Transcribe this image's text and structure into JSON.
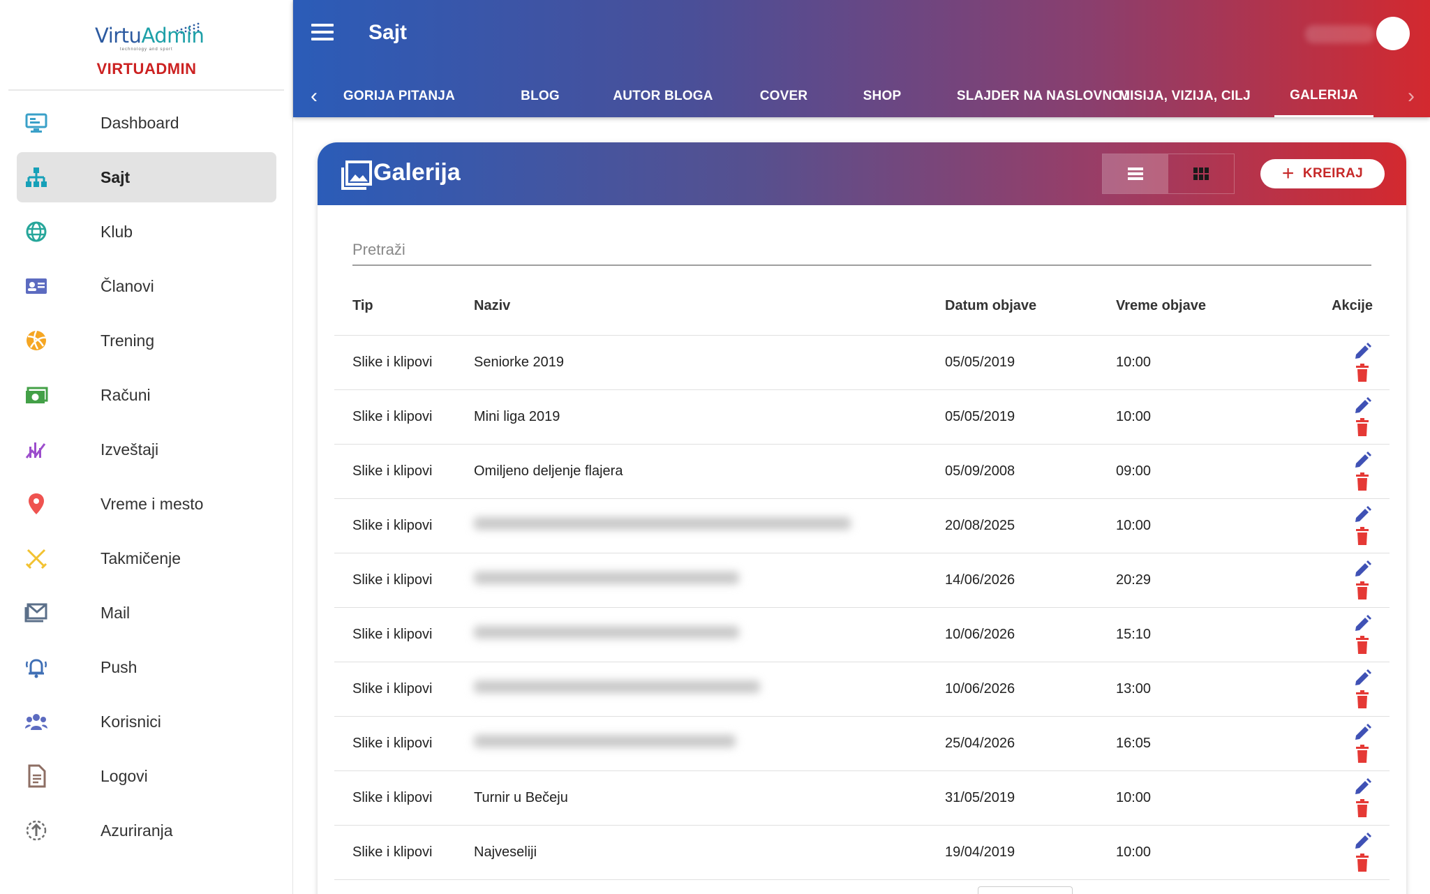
{
  "brand": {
    "logo_text_1": "Virtu",
    "logo_text_2": "Admin",
    "tagline": "technology and sport",
    "name": "VIRTUADMIN"
  },
  "sidebar": {
    "items": [
      {
        "label": "Dashboard",
        "icon": "monitor-icon",
        "color": "#3aa0c8"
      },
      {
        "label": "Sajt",
        "icon": "sitemap-icon",
        "color": "#16a0b8",
        "active": true
      },
      {
        "label": "Klub",
        "icon": "globe-icon",
        "color": "#26a69a"
      },
      {
        "label": "Članovi",
        "icon": "id-card-icon",
        "color": "#5c6bc0"
      },
      {
        "label": "Trening",
        "icon": "volleyball-icon",
        "color": "#f5a623"
      },
      {
        "label": "Računi",
        "icon": "money-icon",
        "color": "#43a047"
      },
      {
        "label": "Izveštaji",
        "icon": "chart-icon",
        "color": "#9c4dcc"
      },
      {
        "label": "Vreme i mesto",
        "icon": "location-pin-icon",
        "color": "#ef5350"
      },
      {
        "label": "Takmičenje",
        "icon": "swords-icon",
        "color": "#f2c230"
      },
      {
        "label": "Mail",
        "icon": "mail-icon",
        "color": "#5b6f89"
      },
      {
        "label": "Push",
        "icon": "bell-icon",
        "color": "#3f6fb5"
      },
      {
        "label": "Korisnici",
        "icon": "users-icon",
        "color": "#5c6bc0"
      },
      {
        "label": "Logovi",
        "icon": "document-icon",
        "color": "#8d6e63"
      },
      {
        "label": "Azuriranja",
        "icon": "update-icon",
        "color": "#6d6d6d"
      }
    ]
  },
  "topbar": {
    "title": "Sajt"
  },
  "tabs": [
    {
      "label": "GORIJA PITANJA"
    },
    {
      "label": "BLOG"
    },
    {
      "label": "AUTOR BLOGA"
    },
    {
      "label": "COVER"
    },
    {
      "label": "SHOP"
    },
    {
      "label": "SLAJDER NA NASLOVNOJ"
    },
    {
      "label": "MISIJA, VIZIJA, CILJ"
    },
    {
      "label": "GALERIJA",
      "active": true
    }
  ],
  "card": {
    "title": "Galerija",
    "create_label": "KREIRAJ",
    "search_placeholder": "Pretraži"
  },
  "table": {
    "headers": {
      "tip": "Tip",
      "naziv": "Naziv",
      "datum": "Datum objave",
      "vreme": "Vreme objave",
      "akcije": "Akcije"
    },
    "rows": [
      {
        "tip": "Slike i klipovi",
        "naziv": "Seniorke 2019",
        "datum": "05/05/2019",
        "vreme": "10:00",
        "blurred": false
      },
      {
        "tip": "Slike i klipovi",
        "naziv": "Mini liga 2019",
        "datum": "05/05/2019",
        "vreme": "10:00",
        "blurred": false
      },
      {
        "tip": "Slike i klipovi",
        "naziv": "Omiljeno deljenje flajera",
        "datum": "05/09/2008",
        "vreme": "09:00",
        "blurred": false
      },
      {
        "tip": "Slike i klipovi",
        "naziv": "",
        "datum": "20/08/2025",
        "vreme": "10:00",
        "blurred": true
      },
      {
        "tip": "Slike i klipovi",
        "naziv": "",
        "datum": "14/06/2026",
        "vreme": "20:29",
        "blurred": true
      },
      {
        "tip": "Slike i klipovi",
        "naziv": "",
        "datum": "10/06/2026",
        "vreme": "15:10",
        "blurred": true
      },
      {
        "tip": "Slike i klipovi",
        "naziv": "",
        "datum": "10/06/2026",
        "vreme": "13:00",
        "blurred": true
      },
      {
        "tip": "Slike i klipovi",
        "naziv": "",
        "datum": "25/04/2026",
        "vreme": "16:05",
        "blurred": true
      },
      {
        "tip": "Slike i klipovi",
        "naziv": "Turnir u Bečeju",
        "datum": "31/05/2019",
        "vreme": "10:00",
        "blurred": false
      },
      {
        "tip": "Slike i klipovi",
        "naziv": "Najveseliji",
        "datum": "19/04/2019",
        "vreme": "10:00",
        "blurred": false
      }
    ]
  },
  "colors": {
    "edit": "#3f51b5",
    "delete": "#e53935",
    "brand_red": "#cc2222"
  }
}
